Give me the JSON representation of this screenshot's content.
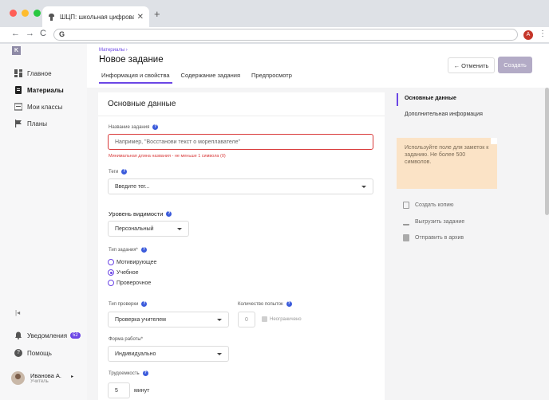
{
  "browser": {
    "tab_title": "ШЦП: школьная цифровая пл...",
    "tab_close": "✕",
    "new_tab": "+",
    "back": "←",
    "forward": "→",
    "reload": "C",
    "omnibox_letter": "G",
    "profile_letter": "A",
    "menu": "⋮",
    "colors": {
      "close": "#ff5f57",
      "min": "#febc2e",
      "max": "#28c840"
    }
  },
  "sidebar": {
    "logo": "K",
    "items": [
      {
        "label": "Главное",
        "icon": "dashboard-icon"
      },
      {
        "label": "Материалы",
        "icon": "document-icon"
      },
      {
        "label": "Мои классы",
        "icon": "class-icon"
      },
      {
        "label": "Планы",
        "icon": "flag-icon"
      }
    ],
    "collapse": "|◂",
    "notifications": {
      "label": "Уведомления",
      "count": "52"
    },
    "help": "Помощь",
    "user": {
      "name": "Иванова А.",
      "role": "Учитель",
      "chevron": "▸"
    }
  },
  "header": {
    "breadcrumb": "Материалы ›",
    "title": "Новое задание",
    "tabs": [
      "Информация и свойства",
      "Содержание задания",
      "Предпросмотр"
    ],
    "cancel": "← Отменить",
    "create": "Создать"
  },
  "form": {
    "section_title": "Основные данные",
    "name_label": "Название задания",
    "name_placeholder": "Например, \"Восстанови текст о мореплавателе\"",
    "name_error": "Минимальная длина названия - не меньше 1 символа (0)",
    "tags_label": "Теги",
    "tags_placeholder": "Введите тег...",
    "visibility_label": "Уровень видимости",
    "visibility_value": "Персональный",
    "type_label": "Тип задания*",
    "types": [
      "Мотивирующее",
      "Учебное",
      "Проверочное"
    ],
    "type_selected": "Учебное",
    "check_label": "Тип проверки",
    "check_value": "Проверка учителем",
    "attempts_label": "Количество попыток",
    "attempts_value": "0",
    "unlimited": "Неограничено",
    "work_form_label": "Форма работы*",
    "work_form_value": "Индивидуально",
    "effort_label": "Трудоемкость",
    "effort_value": "5",
    "effort_unit": "минут",
    "help_glyph": "?"
  },
  "right_panel": {
    "nav": [
      "Основные данные",
      "Дополнительная информация"
    ],
    "note": "Используйте поле для заметок к заданию. Не более 500 символов.",
    "actions": [
      "Создать копию",
      "Выгрузить задание",
      "Отправить в архив"
    ]
  },
  "colors": {
    "accent": "#6b46e5",
    "error": "#d93a3a",
    "note_bg": "#fbe3c6",
    "create_btn": "#b3abc6"
  }
}
